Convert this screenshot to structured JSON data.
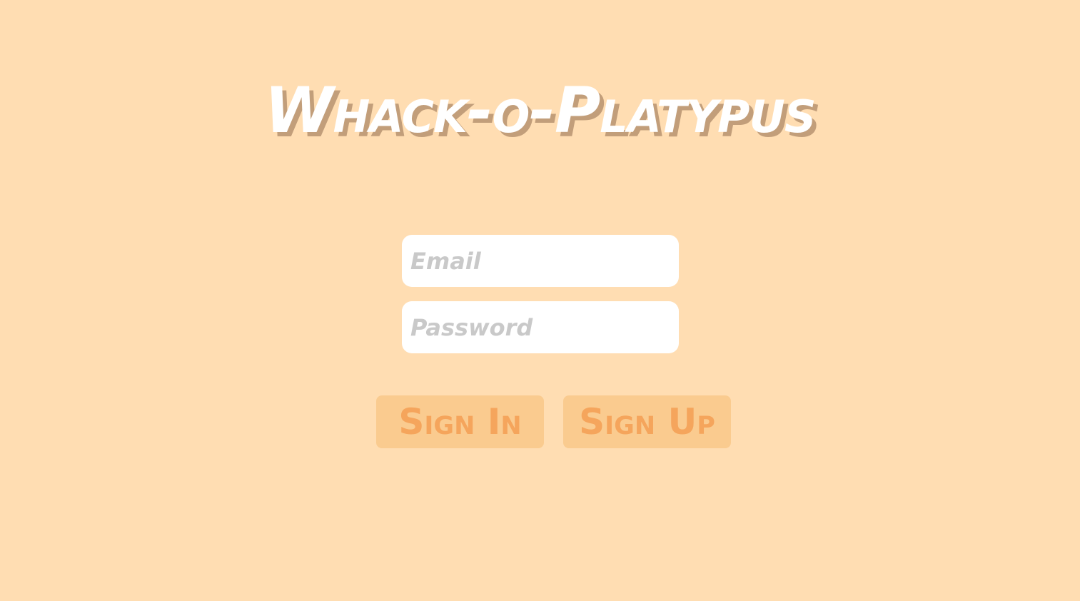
{
  "app": {
    "title": "Whack-o-Platypus"
  },
  "login_form": {
    "email_placeholder": "Email",
    "password_placeholder": "Password",
    "sign_in_label": "Sign In",
    "sign_up_label": "Sign Up"
  },
  "colors": {
    "background": "#FFDDB2",
    "title_text": "#FFFFFF",
    "title_shadow": "#C29E7A",
    "input_background": "#FFFFFF",
    "placeholder_text": "#C9C9C9",
    "button_background": "#FACB8F",
    "button_text": "#F5A55C"
  }
}
